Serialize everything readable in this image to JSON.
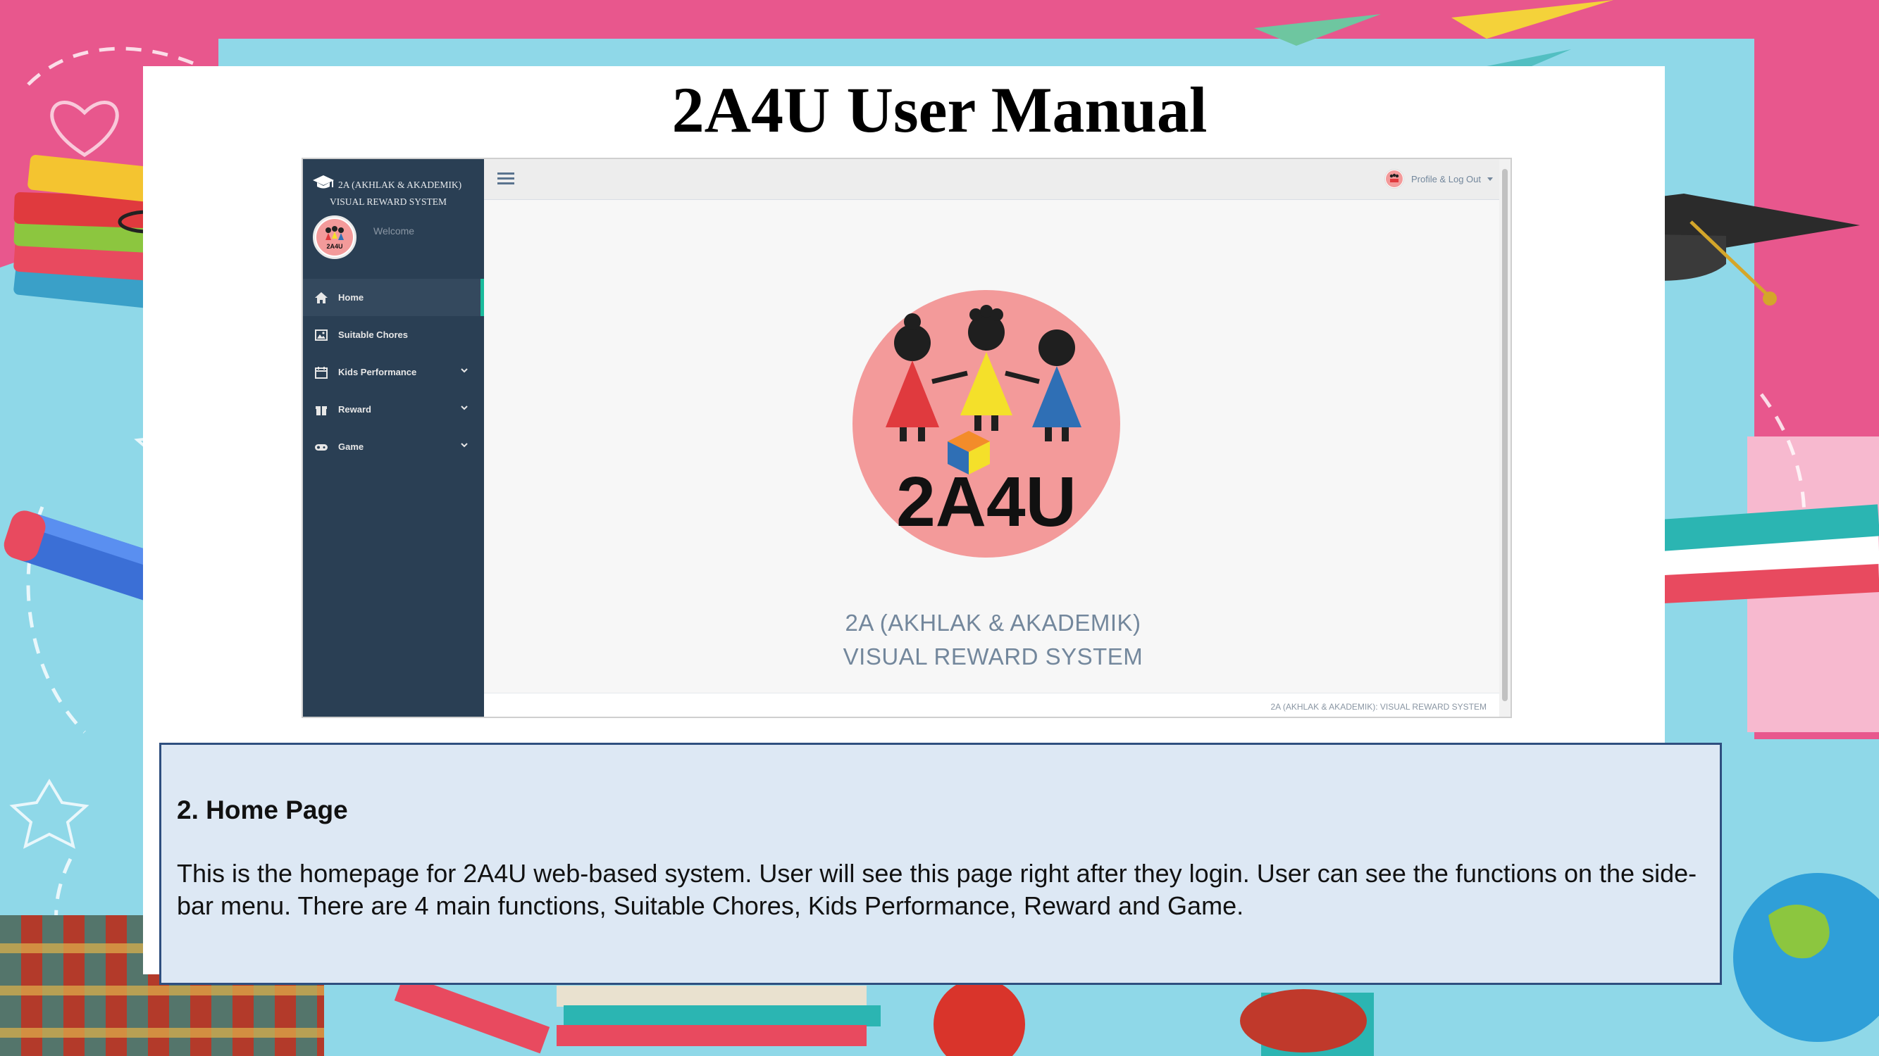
{
  "document": {
    "title": "2A4U User Manual"
  },
  "app_screenshot": {
    "sidebar": {
      "brand_line1": "2A (AKHLAK & AKADEMIK)",
      "brand_line2": "VISUAL REWARD SYSTEM",
      "welcome": "Welcome",
      "items": [
        {
          "label": "Home",
          "icon": "home-icon",
          "active": true,
          "has_submenu": false
        },
        {
          "label": "Suitable Chores",
          "icon": "image-icon",
          "active": false,
          "has_submenu": false
        },
        {
          "label": "Kids Performance",
          "icon": "calendar-icon",
          "active": false,
          "has_submenu": true
        },
        {
          "label": "Reward",
          "icon": "gift-icon",
          "active": false,
          "has_submenu": true
        },
        {
          "label": "Game",
          "icon": "gamepad-icon",
          "active": false,
          "has_submenu": true
        }
      ]
    },
    "topbar": {
      "profile_label": "Profile & Log Out"
    },
    "content": {
      "logo_text": "2A4U",
      "system_line1": "2A (AKHLAK & AKADEMIK)",
      "system_line2": "VISUAL REWARD SYSTEM"
    },
    "footer": {
      "text": "2A (AKHLAK & AKADEMIK): VISUAL REWARD SYSTEM"
    },
    "colors": {
      "sidebar": "#2a3f54",
      "accent": "#1abb9c",
      "logo_circle": "#f39a9a"
    }
  },
  "description": {
    "heading": "2. Home Page",
    "body": "This is the homepage for 2A4U web-based system. User will see this page right after they login. User can see the functions on the side-bar menu. There are 4 main functions, Suitable Chores, Kids Performance, Reward and Game."
  }
}
